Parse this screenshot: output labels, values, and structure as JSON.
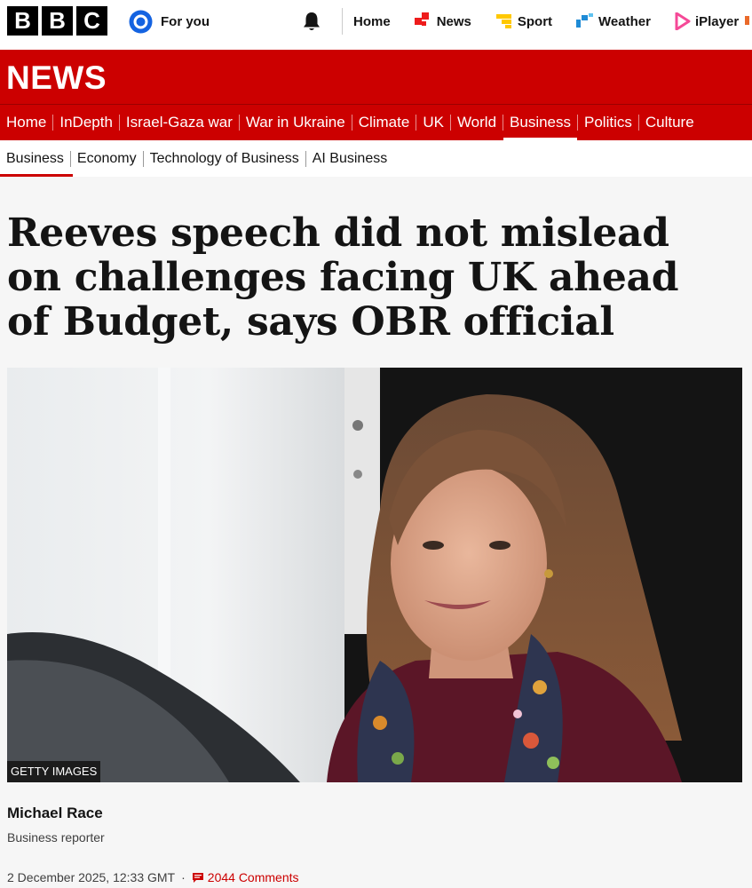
{
  "top_bar": {
    "logo_letters": [
      "B",
      "B",
      "C"
    ],
    "for_you_label": "For you",
    "nav": [
      {
        "label": "Home",
        "icon": "none"
      },
      {
        "label": "News",
        "icon": "news-icon"
      },
      {
        "label": "Sport",
        "icon": "sport-icon"
      },
      {
        "label": "Weather",
        "icon": "weather-icon"
      },
      {
        "label": "iPlayer",
        "icon": "iplayer-icon"
      }
    ]
  },
  "news_banner": {
    "title": "NEWS",
    "nav": [
      "Home",
      "InDepth",
      "Israel-Gaza war",
      "War in Ukraine",
      "Climate",
      "UK",
      "World",
      "Business",
      "Politics",
      "Culture"
    ],
    "active": "Business"
  },
  "sub_nav": {
    "items": [
      "Business",
      "Economy",
      "Technology of Business",
      "AI Business"
    ],
    "active": "Business"
  },
  "article": {
    "headline": "Reeves speech did not mislead on challenges facing UK ahead of Budget, says OBR official",
    "image_credit": "GETTY IMAGES",
    "author": "Michael Race",
    "author_role": "Business reporter",
    "timestamp": "2 December 2025, 12:33 GMT",
    "comments": "2044 Comments"
  },
  "colors": {
    "brand_red": "#cc0000",
    "news_icon": "#ee1c1c",
    "sport_icon": "#ffc800",
    "weather_icon": "#1f8bd6",
    "iplayer_icon": "#f54997"
  }
}
